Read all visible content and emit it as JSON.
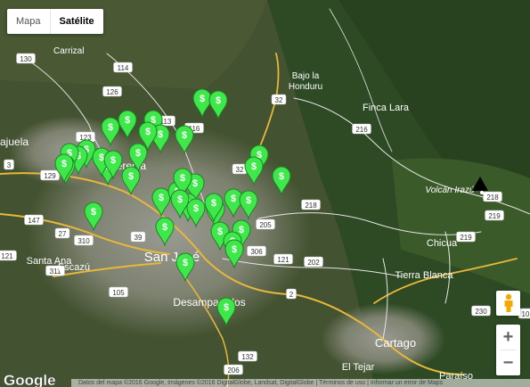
{
  "map_type_control": {
    "options": [
      "Mapa",
      "Satélite"
    ],
    "active": "Satélite"
  },
  "place_labels": [
    {
      "name": "Carrizal"
    },
    {
      "name": "Bajo la"
    },
    {
      "name": "Honduru"
    },
    {
      "name": "Finca Lara"
    },
    {
      "name": "Volcán Irazú"
    },
    {
      "name": "Heredia"
    },
    {
      "name": "ajuela"
    },
    {
      "name": "San José"
    },
    {
      "name": "Santa Ana"
    },
    {
      "name": "Escazú"
    },
    {
      "name": "Desamparados"
    },
    {
      "name": "Chicua"
    },
    {
      "name": "Tierra Blanca"
    },
    {
      "name": "Cartago"
    },
    {
      "name": "El Tejar"
    },
    {
      "name": "Paraíso"
    }
  ],
  "route_shields": [
    "130",
    "114",
    "126",
    "32",
    "113",
    "116",
    "123",
    "216",
    "129",
    "3",
    "32",
    "218",
    "218",
    "147",
    "27",
    "310",
    "121",
    "39",
    "205",
    "306",
    "121",
    "202",
    "219",
    "219",
    "311",
    "105",
    "2",
    "230",
    "10",
    "206",
    "132"
  ],
  "marker_symbol": "$",
  "marker_count": 40,
  "volcano_icon": "triangle-peak-icon",
  "controls": {
    "zoom_in": "+",
    "zoom_out": "−",
    "street_view_icon": "pegman-icon"
  },
  "logo": "Google",
  "attribution": "Datos del mapa ©2016 Google, Imágenes ©2016 DigitalGlobe, Landsat, DigitalGlobe | Términos de uso | Informar un error de Maps"
}
